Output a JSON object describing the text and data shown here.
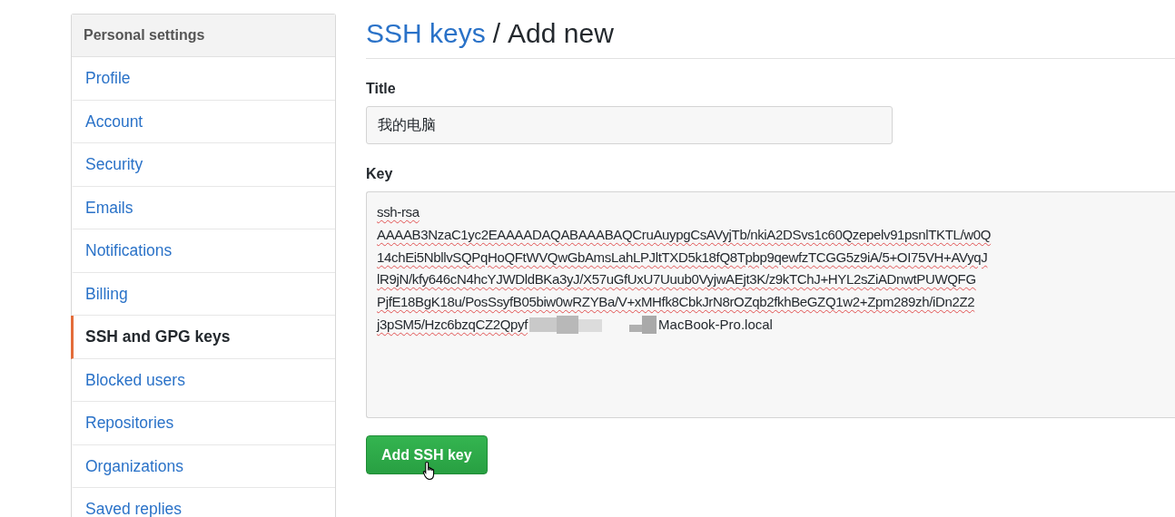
{
  "sidebar": {
    "header": "Personal settings",
    "items": [
      {
        "label": "Profile",
        "selected": false
      },
      {
        "label": "Account",
        "selected": false
      },
      {
        "label": "Security",
        "selected": false
      },
      {
        "label": "Emails",
        "selected": false
      },
      {
        "label": "Notifications",
        "selected": false
      },
      {
        "label": "Billing",
        "selected": false
      },
      {
        "label": "SSH and GPG keys",
        "selected": true
      },
      {
        "label": "Blocked users",
        "selected": false
      },
      {
        "label": "Repositories",
        "selected": false
      },
      {
        "label": "Organizations",
        "selected": false
      },
      {
        "label": "Saved replies",
        "selected": false
      }
    ]
  },
  "heading": {
    "link": "SSH keys",
    "separator": "/",
    "title": "Add new"
  },
  "form": {
    "title_label": "Title",
    "title_value": "我的电脑",
    "key_label": "Key",
    "key_lines": [
      "ssh-rsa",
      "AAAAB3NzaC1yc2EAAAADAQABAAABAQCruAuypgCsAVyjTb/nkiA2DSvs1c60Qzepelv91psnlTKTL/w0Q",
      "14chEi5NbllvSQPqHoQFtWVQwGbAmsLahLPJltTXD5k18fQ8Tpbp9qewfzTCGG5z9iA/5+OI75VH+AVyqJ",
      "lR9jN/kfy646cN4hcYJWDldBKa3yJ/X57uGfUxU7Uuub0VyjwAEjt3K/z9kTChJ+HYL2sZiADnwtPUWQFG",
      "PjfE18BgK18u/PosSsyfB05biw0wRZYBa/V+xMHfk8CbkJrN8rOZqb2fkhBeGZQ1w2+Zpm289zh/iDn2Z2"
    ],
    "key_last_line": {
      "before": "j3pSM5/Hzc6bzqCZ2Qpyf",
      "after": "MacBook-Pro.local"
    },
    "submit": "Add SSH key"
  }
}
